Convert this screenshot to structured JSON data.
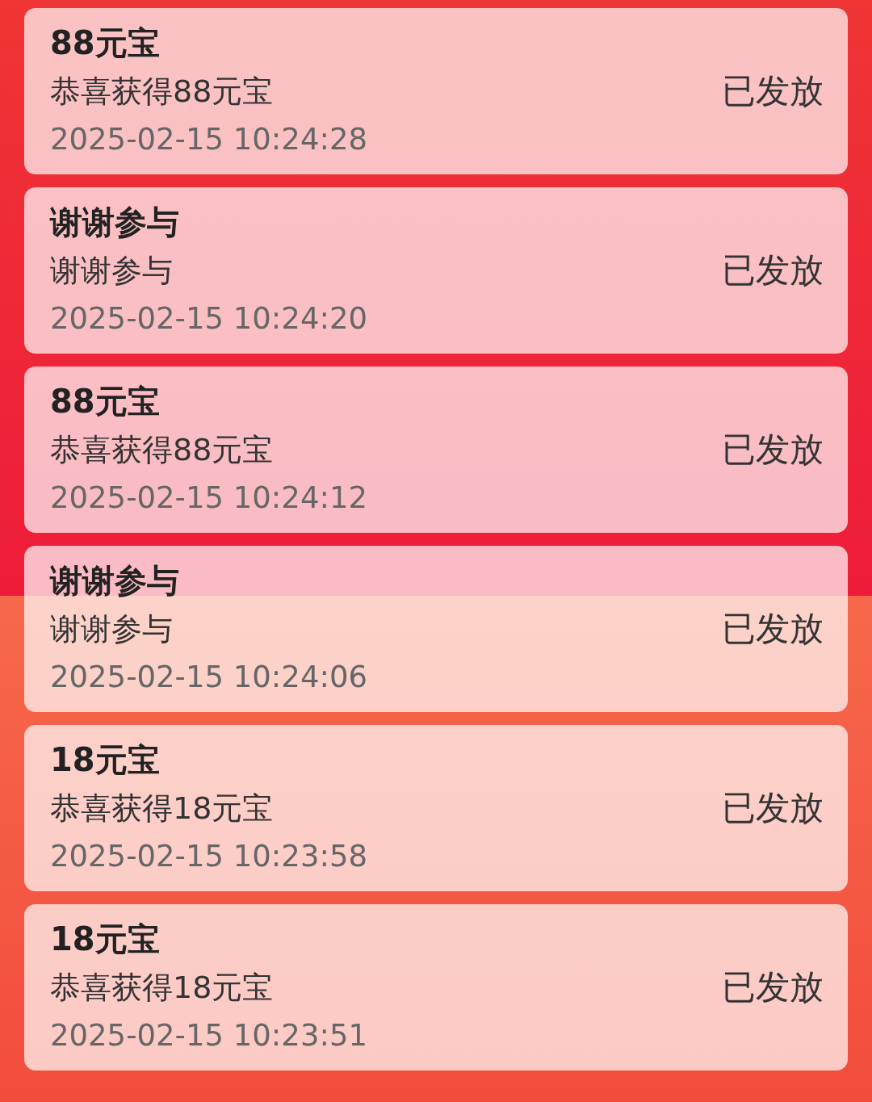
{
  "records": [
    {
      "title": "88元宝",
      "description": "恭喜获得88元宝",
      "time": "2025-02-15 10:24:28",
      "status": "已发放"
    },
    {
      "title": "谢谢参与",
      "description": "谢谢参与",
      "time": "2025-02-15 10:24:20",
      "status": "已发放"
    },
    {
      "title": "88元宝",
      "description": "恭喜获得88元宝",
      "time": "2025-02-15 10:24:12",
      "status": "已发放"
    },
    {
      "title": "谢谢参与",
      "description": "谢谢参与",
      "time": "2025-02-15 10:24:06",
      "status": "已发放"
    },
    {
      "title": "18元宝",
      "description": "恭喜获得18元宝",
      "time": "2025-02-15 10:23:58",
      "status": "已发放"
    },
    {
      "title": "18元宝",
      "description": "恭喜获得18元宝",
      "time": "2025-02-15 10:23:51",
      "status": "已发放"
    }
  ]
}
